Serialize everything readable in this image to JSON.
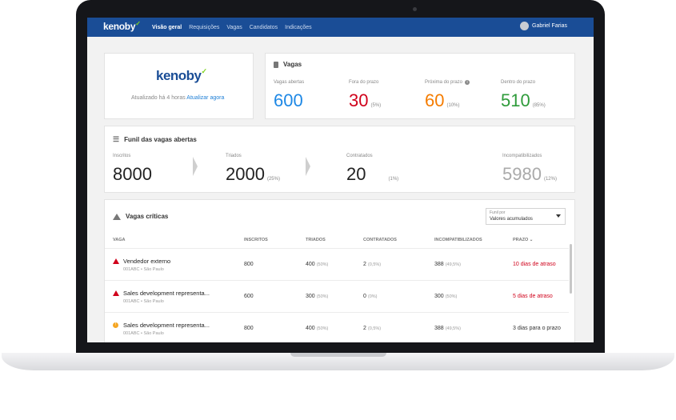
{
  "nav": {
    "logo": "kenoby",
    "items": [
      "Visão geral",
      "Requisições",
      "Vagas",
      "Candidatos",
      "Indicações"
    ],
    "user": "Gabriel Farias"
  },
  "brand": {
    "logo": "kenoby",
    "updated": "Atualizado há 4 horas",
    "update_link": "Atualizar agora"
  },
  "vagas": {
    "title": "Vagas",
    "stats": [
      {
        "label": "Vagas abertas",
        "value": "600",
        "pct": "",
        "color": "#1e88e5"
      },
      {
        "label": "Fora do prazo",
        "value": "30",
        "pct": "(5%)",
        "color": "#d0021b"
      },
      {
        "label": "Próxima do prazo",
        "value": "60",
        "pct": "(10%)",
        "color": "#f57c00"
      },
      {
        "label": "Dentro do prazo",
        "value": "510",
        "pct": "(85%)",
        "color": "#2e9b3a"
      }
    ]
  },
  "funnel": {
    "title": "Funil das vagas abertas",
    "stages": [
      {
        "label": "Inscritos",
        "value": "8000",
        "pct": ""
      },
      {
        "label": "Triados",
        "value": "2000",
        "pct": "(25%)"
      },
      {
        "label": "Contratados",
        "value": "20",
        "pct": "(1%)"
      },
      {
        "label": "Incompatibilizados",
        "value": "5980",
        "pct": "(12%)"
      }
    ]
  },
  "critical": {
    "title": "Vagas críticas",
    "select_label": "Funil por",
    "select_value": "Valores acumulados",
    "columns": [
      "VAGA",
      "INSCRITOS",
      "TRIADOS",
      "CONTRATADOS",
      "INCOMPATIBILIZADOS",
      "PRAZO"
    ],
    "rows": [
      {
        "name": "Vendedor externo",
        "sub": "001ABC • São Paulo",
        "inscritos": "800",
        "triados": "400",
        "triados_pct": "(50%)",
        "contratados": "2",
        "contratados_pct": "(0,5%)",
        "incomp": "388",
        "incomp_pct": "(49,5%)",
        "prazo": "10 dias de atraso",
        "status": "late"
      },
      {
        "name": "Sales development representa...",
        "sub": "001ABC • São Paulo",
        "inscritos": "600",
        "triados": "300",
        "triados_pct": "(50%)",
        "contratados": "0",
        "contratados_pct": "(0%)",
        "incomp": "300",
        "incomp_pct": "(50%)",
        "prazo": "5 dias de atraso",
        "status": "late"
      },
      {
        "name": "Sales development representa...",
        "sub": "001ABC • São Paulo",
        "inscritos": "800",
        "triados": "400",
        "triados_pct": "(50%)",
        "contratados": "2",
        "contratados_pct": "(0,5%)",
        "incomp": "388",
        "incomp_pct": "(49,5%)",
        "prazo": "3 dias para o prazo",
        "status": "warning"
      }
    ]
  }
}
